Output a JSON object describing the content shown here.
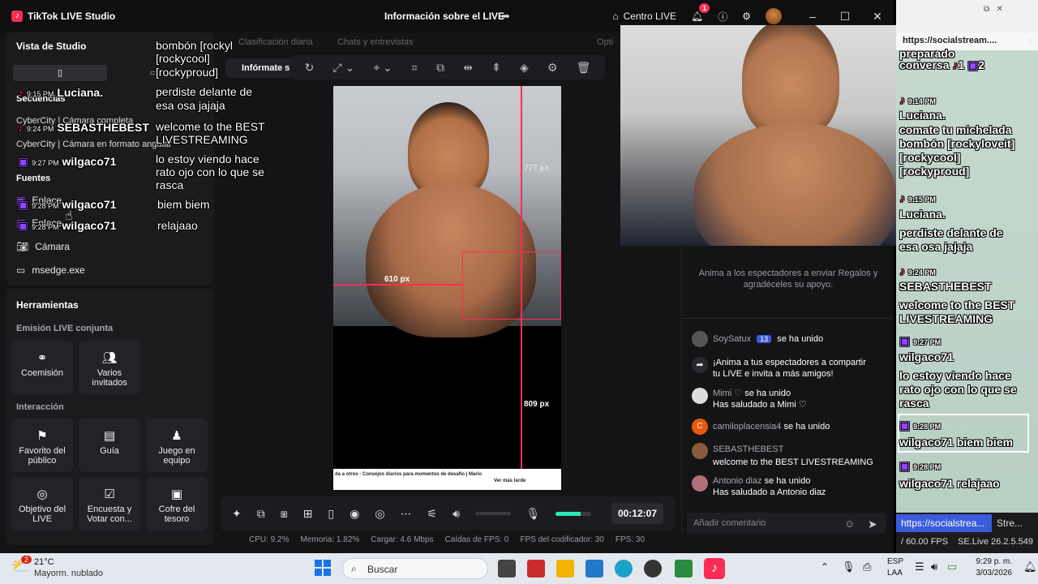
{
  "window": {
    "title": "TikTok LIVE Studio",
    "center_title": "Información sobre el LIVE",
    "centro_live": "Centro LIVE",
    "notif_count": "1"
  },
  "left": {
    "vista_title": "Vista de Studio",
    "secuencias_title": "Secuencias",
    "secuencia_1": "CyberCity | Cámara completa",
    "secuencia_2": "CyberCity | Cámara en formato angular",
    "fuentes_title": "Fuentes",
    "fuente_1": "Enlace",
    "fuente_2": "Enlace",
    "fuente_3": "Cámara",
    "fuente_4": "msedge.exe",
    "herramientas_title": "Herramientas",
    "emision_title": "Emisión LIVE conjunta",
    "tile_coemision": "Coemisión",
    "tile_varios": "Varios invitados",
    "interaccion_title": "Interacción",
    "tile_favorito": "Favorito del público",
    "tile_guia": "Guía",
    "tile_juego": "Juego en equipo",
    "tile_objetivo": "Objetivo del LIVE",
    "tile_encuesta": "Encuesta y Votar con...",
    "tile_cofre": "Cofre del tesoro"
  },
  "tabs": {
    "clasificacion": "Clasificación diaria",
    "chats": "Chats y entrevistas",
    "opti": "Opti",
    "informate": "Infórmate s"
  },
  "preview": {
    "px_777": "777 px",
    "px_610": "610 px",
    "px_809": "809 px",
    "ticker_text": "da a otros - Consejos diarios para momentos de desafío | Mario",
    "ticker_more": "Ver más tarde"
  },
  "controls": {
    "timer": "00:12:07"
  },
  "stats": {
    "cpu": "CPU: 9.2%",
    "memoria": "Memoria: 1.82%",
    "cargar": "Cargar: 4.6 Mbps",
    "caidas": "Caídas de FPS: 0",
    "fps_cod": "FPS del codificador: 30",
    "fps": "FPS: 30"
  },
  "chat": {
    "gift_tip": "Anima a los espectadores a enviar Regalos y agradéceles su apoyo.",
    "r1_name": "SoySatux",
    "r1_level": "13",
    "r1_msg": "se ha unido",
    "r2_msg": "¡Anima a tus espectadores a compartir tu LIVE e invita a más amigos!",
    "r3_name": "Mimi ♡",
    "r3_msg": "se ha unido",
    "r3_msg2": "Has saludado a Mimi ♡",
    "r4_name": "camiloplacensia4",
    "r4_msg": "se ha unido",
    "r5_name": "SEBASTHEBEST",
    "r5_msg": "welcome to the BEST LIVESTREAMING",
    "r6_name": "Antonio diaz",
    "r6_msg": "se ha unido",
    "r6_msg2": "Has saludado a Antonio diaz",
    "input_placeholder": "Añadir comentario"
  },
  "overlay": {
    "l1": "bombón [rockyl",
    "l2": "[rockycool]",
    "l3": "[rockyproud]",
    "t1": "9:15 PM",
    "n1": "Luciana.",
    "m1a": "perdiste delante de",
    "m1b": "esa osa",
    "m1c": "jajaja",
    "t2": "9:24 PM",
    "n2": "SEBASTHEBEST",
    "m2a": "welcome to the BEST",
    "m2b": "LIVESTREAMING",
    "t3": "9:27 PM",
    "n3": "wilgaco71",
    "m3a": "lo estoy viendo hace",
    "m3b": "rato ojo con lo que se",
    "m3c": "rasca",
    "t4": "9:28 PM",
    "n4": "wilgaco71",
    "m4": "biem biem",
    "t5": "9:28 PM",
    "n5": "wilgaco71",
    "m5": "relajaao"
  },
  "social": {
    "url": "https://socialstream....",
    "tab1": "https://socialstrea...",
    "tab2": "Stre...",
    "fps": "/ 60.00 FPS",
    "version": "SE.Live 26.2.5.549",
    "lines": {
      "a": "preparado",
      "b": "conversa",
      "c": "9:14 PM",
      "d": "Luciana.",
      "e": "comate tu michelada",
      "f": "bombón [rockyloveit]",
      "g": "[rockycool]",
      "h": "[rockyproud]",
      "i": "9:15 PM",
      "j": "Luciana.",
      "k": "perdiste delante de",
      "l": "esa osa",
      "m": "jajaja",
      "n": "9:24 PM",
      "o": "SEBASTHEBEST",
      "p": "welcome to the BEST",
      "q": "LIVESTREAMING",
      "r": "9:27 PM",
      "s": "wilgaco71",
      "t": "lo estoy viendo hace",
      "u": "rato ojo con lo que se",
      "v": "rasca",
      "w": "9:28 PM",
      "x": "wilgaco71",
      "y": "biem biem",
      "z": "9:28 PM",
      "aa": "wilgaco71",
      "ab": "relajaao",
      "cnt1": "1",
      "cnt2": "2"
    }
  },
  "taskbar": {
    "temp": "21°C",
    "weather": "Mayorm. nublado",
    "weather_badge": "2",
    "search": "Buscar",
    "lang1": "ESP",
    "lang2": "LAA",
    "time": "9:29 p. m.",
    "date": "3/03/2026"
  },
  "colors": {
    "tiktok_pink": "#fe2c55",
    "accent_mint": "#2ee6b6",
    "twitch_purple": "#9146ff"
  }
}
